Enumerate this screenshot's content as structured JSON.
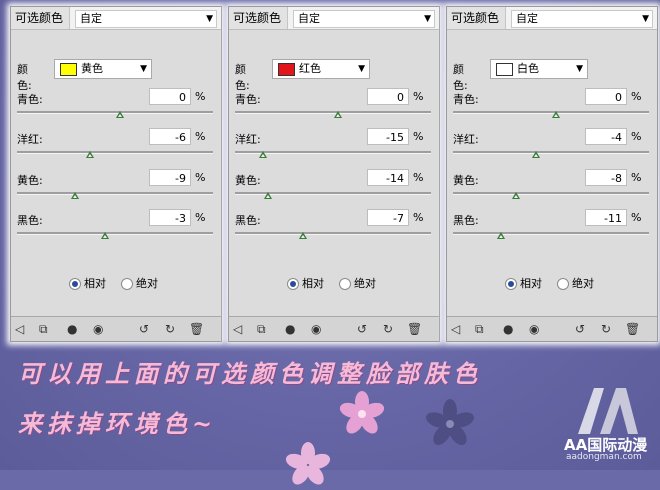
{
  "panels": [
    {
      "title": "可选颜色",
      "preset": "自定",
      "color_label": "颜色:",
      "color_name": "黄色",
      "swatch": "#ffff00",
      "sliders": [
        {
          "label": "青色:",
          "value": "0",
          "unit": "%",
          "level": 0
        },
        {
          "label": "洋红:",
          "value": "-6",
          "unit": "%",
          "level": -6
        },
        {
          "label": "黄色:",
          "value": "-9",
          "unit": "%",
          "level": -9
        },
        {
          "label": "黑色:",
          "value": "-3",
          "unit": "%",
          "level": -3
        }
      ],
      "relative_label": "相对",
      "absolute_label": "绝对",
      "mode": "relative"
    },
    {
      "title": "可选颜色",
      "preset": "自定",
      "color_label": "颜色:",
      "color_name": "红色",
      "swatch": "#e0161c",
      "sliders": [
        {
          "label": "青色:",
          "value": "0",
          "unit": "%",
          "level": 0
        },
        {
          "label": "洋红:",
          "value": "-15",
          "unit": "%",
          "level": -15
        },
        {
          "label": "黄色:",
          "value": "-14",
          "unit": "%",
          "level": -14
        },
        {
          "label": "黑色:",
          "value": "-7",
          "unit": "%",
          "level": -7
        }
      ],
      "relative_label": "相对",
      "absolute_label": "绝对",
      "mode": "relative"
    },
    {
      "title": "可选颜色",
      "preset": "自定",
      "color_label": "颜色:",
      "color_name": "白色",
      "swatch": "#ffffff",
      "sliders": [
        {
          "label": "青色:",
          "value": "0",
          "unit": "%",
          "level": 0
        },
        {
          "label": "洋红:",
          "value": "-4",
          "unit": "%",
          "level": -4
        },
        {
          "label": "黄色:",
          "value": "-8",
          "unit": "%",
          "level": -8
        },
        {
          "label": "黑色:",
          "value": "-11",
          "unit": "%",
          "level": -11
        }
      ],
      "relative_label": "相对",
      "absolute_label": "绝对",
      "mode": "relative"
    }
  ],
  "footer_icons": [
    "back-arrow-icon",
    "clip-layer-icon",
    "visibility-state-icon",
    "eye-icon",
    "reset-icon",
    "refresh-icon",
    "trash-icon"
  ],
  "caption": {
    "line1": "可以用上面的可选颜色调整脸部肤色",
    "line2": "来抹掉环境色~"
  },
  "logo": {
    "name": "AA国际动漫",
    "url": "aadongman.com"
  },
  "colors": {
    "background": "#6a6aa8",
    "caption": "#f6b9d6",
    "slider_thumb": "#3a7a3a"
  }
}
